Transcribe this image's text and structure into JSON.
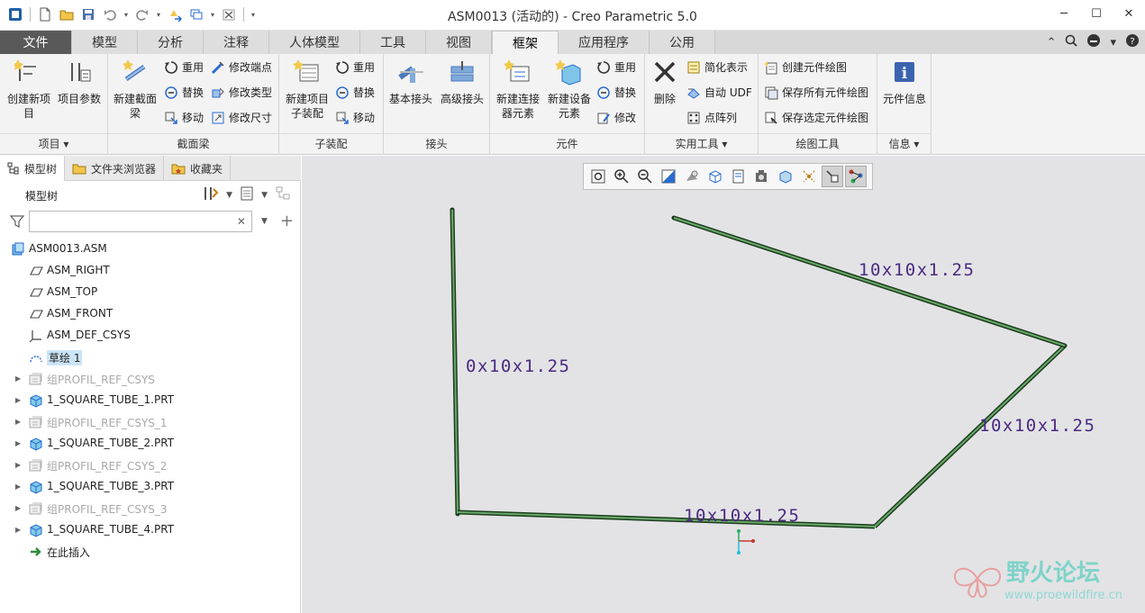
{
  "window": {
    "title": "ASM0013 (活动的) - Creo Parametric 5.0",
    "controls": [
      "─",
      "☐",
      "✕"
    ]
  },
  "tabs": {
    "file": "文件",
    "items": [
      "模型",
      "分析",
      "注释",
      "人体模型",
      "工具",
      "视图",
      "框架",
      "应用程序",
      "公用"
    ],
    "active": "框架"
  },
  "ribbon": {
    "items_group": {
      "label": "项目 ▾",
      "create_item": "创建新项目",
      "item_params": "项目参数"
    },
    "section_beam": {
      "label": "截面梁",
      "new_section_beam": "新建截面梁",
      "reuse": "重用",
      "replace": "替换",
      "move": "移动",
      "modify_endpoint": "修改端点",
      "modify_type": "修改类型",
      "modify_size": "修改尺寸"
    },
    "subassembly": {
      "label": "子装配",
      "new_item_subassembly": "新建项目子装配",
      "reuse": "重用",
      "replace": "替换",
      "move": "移动"
    },
    "joint": {
      "label": "接头",
      "basic_joint": "基本接头",
      "advanced_joint": "高级接头"
    },
    "component": {
      "label": "元件",
      "new_connector": "新建连接器元素",
      "new_device": "新建设备元素",
      "reuse": "重用",
      "replace": "替换",
      "modify": "修改"
    },
    "utilities": {
      "label": "实用工具 ▾",
      "delete": "删除",
      "simplified_rep": "简化表示",
      "auto_udf": "自动 UDF",
      "point_pattern": "点阵列"
    },
    "drawing": {
      "label": "绘图工具",
      "create_component_drawing": "创建元件绘图",
      "save_all_drawings": "保存所有元件绘图",
      "save_selected_drawings": "保存选定元件绘图"
    },
    "info": {
      "label": "信息 ▾",
      "component_info": "元件信息"
    }
  },
  "left_panel": {
    "tabs": [
      "模型树",
      "文件夹浏览器",
      "收藏夹"
    ],
    "header": "模型树",
    "filter_placeholder": "",
    "tree": [
      {
        "label": "ASM0013.ASM",
        "icon": "assembly-icon",
        "indent": 0,
        "expandable": false,
        "dim": false
      },
      {
        "label": "ASM_RIGHT",
        "icon": "datum-plane-icon",
        "indent": 1,
        "expandable": false,
        "dim": false
      },
      {
        "label": "ASM_TOP",
        "icon": "datum-plane-icon",
        "indent": 1,
        "expandable": false,
        "dim": false
      },
      {
        "label": "ASM_FRONT",
        "icon": "datum-plane-icon",
        "indent": 1,
        "expandable": false,
        "dim": false
      },
      {
        "label": "ASM_DEF_CSYS",
        "icon": "csys-icon",
        "indent": 1,
        "expandable": false,
        "dim": false
      },
      {
        "label": "草绘 1",
        "icon": "sketch-icon",
        "indent": 1,
        "expandable": false,
        "dim": false,
        "selected": true
      },
      {
        "label": "组PROFIL_REF_CSYS",
        "icon": "group-icon",
        "indent": 1,
        "expandable": true,
        "dim": true
      },
      {
        "label": "1_SQUARE_TUBE_1.PRT",
        "icon": "part-icon",
        "indent": 1,
        "expandable": true,
        "dim": false
      },
      {
        "label": "组PROFIL_REF_CSYS_1",
        "icon": "group-icon",
        "indent": 1,
        "expandable": true,
        "dim": true
      },
      {
        "label": "1_SQUARE_TUBE_2.PRT",
        "icon": "part-icon",
        "indent": 1,
        "expandable": true,
        "dim": false
      },
      {
        "label": "组PROFIL_REF_CSYS_2",
        "icon": "group-icon",
        "indent": 1,
        "expandable": true,
        "dim": true
      },
      {
        "label": "1_SQUARE_TUBE_3.PRT",
        "icon": "part-icon",
        "indent": 1,
        "expandable": true,
        "dim": false
      },
      {
        "label": "组PROFIL_REF_CSYS_3",
        "icon": "group-icon",
        "indent": 1,
        "expandable": true,
        "dim": true
      },
      {
        "label": "1_SQUARE_TUBE_4.PRT",
        "icon": "part-icon",
        "indent": 1,
        "expandable": true,
        "dim": false
      },
      {
        "label": "在此插入",
        "icon": "insert-arrow-icon",
        "indent": 1,
        "expandable": false,
        "dim": false
      }
    ]
  },
  "graphics": {
    "beam_labels": [
      "0x10x1.25",
      "10x10x1.25",
      "10x10x1.25",
      "10x10x1.25"
    ],
    "beam_color": "#3f7a3f",
    "label_color": "#5a3a8a",
    "watermark_text": "野火论坛",
    "watermark_url": "www.proewildfire.cn"
  }
}
